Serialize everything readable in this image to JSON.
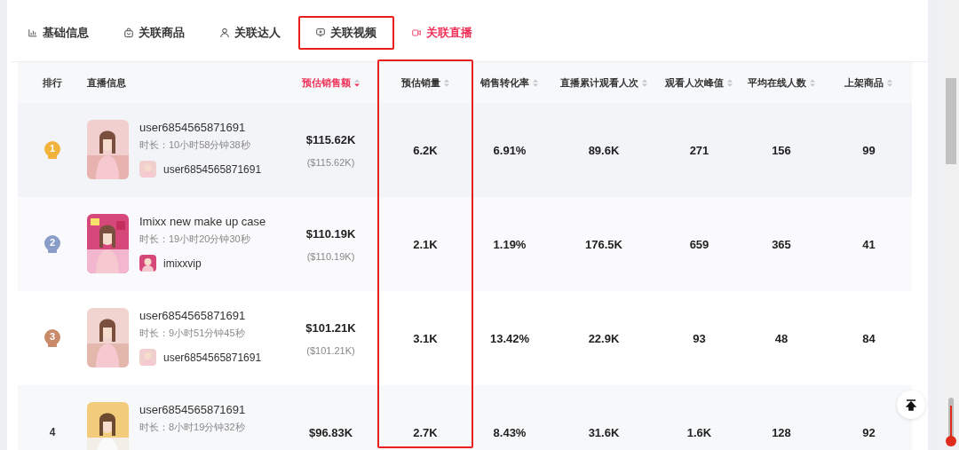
{
  "tabs": [
    {
      "label": "基础信息",
      "selected": false,
      "highlighted": false
    },
    {
      "label": "关联商品",
      "selected": false,
      "highlighted": false
    },
    {
      "label": "关联达人",
      "selected": false,
      "highlighted": false
    },
    {
      "label": "关联视频",
      "selected": false,
      "highlighted": true
    },
    {
      "label": "关联直播",
      "selected": true,
      "highlighted": false
    }
  ],
  "table": {
    "columns": [
      {
        "label": "排行",
        "sortable": false,
        "sorted": false,
        "highlighted": false
      },
      {
        "label": "直播信息",
        "sortable": false,
        "sorted": false,
        "highlighted": false
      },
      {
        "label": "预估销售额",
        "sortable": true,
        "sorted": true,
        "highlighted": false
      },
      {
        "label": "预估销量",
        "sortable": true,
        "sorted": false,
        "highlighted": true
      },
      {
        "label": "销售转化率",
        "sortable": true,
        "sorted": false,
        "highlighted": false
      },
      {
        "label": "直播累计观看人次",
        "sortable": true,
        "sorted": false,
        "highlighted": false
      },
      {
        "label": "观看人次峰值",
        "sortable": true,
        "sorted": false,
        "highlighted": false
      },
      {
        "label": "平均在线人数",
        "sortable": true,
        "sorted": false,
        "highlighted": false
      },
      {
        "label": "上架商品",
        "sortable": true,
        "sorted": false,
        "highlighted": false
      }
    ],
    "rows": [
      {
        "rank": "1",
        "kind": "medal",
        "color": "#f2b33d",
        "title": "user6854565871691",
        "duration": "时长：10小时58分钟38秒",
        "author": "user6854565871691",
        "sales": "$115.62K",
        "sales_sub": "($115.62K)",
        "volume": "6.2K",
        "conversion": "6.91%",
        "views": "89.6K",
        "peak": "271",
        "online": "156",
        "products": "99"
      },
      {
        "rank": "2",
        "kind": "medal",
        "color": "#8a9cc8",
        "title": "Imixx new make up case",
        "duration": "时长：19小时20分钟30秒",
        "author": "imixxvip",
        "sales": "$110.19K",
        "sales_sub": "($110.19K)",
        "volume": "2.1K",
        "conversion": "1.19%",
        "views": "176.5K",
        "peak": "659",
        "online": "365",
        "products": "41"
      },
      {
        "rank": "3",
        "kind": "medal",
        "color": "#c98a6a",
        "title": "user6854565871691",
        "duration": "时长：9小时51分钟45秒",
        "author": "user6854565871691",
        "sales": "$101.21K",
        "sales_sub": "($101.21K)",
        "volume": "3.1K",
        "conversion": "13.42%",
        "views": "22.9K",
        "peak": "93",
        "online": "48",
        "products": "84"
      },
      {
        "rank": "4",
        "kind": "plain",
        "title": "user6854565871691",
        "duration": "时长：8小时19分钟32秒",
        "sales": "$96.83K",
        "volume": "2.7K",
        "conversion": "8.43%",
        "views": "31.6K",
        "peak": "1.6K",
        "online": "128",
        "products": "92"
      }
    ]
  }
}
